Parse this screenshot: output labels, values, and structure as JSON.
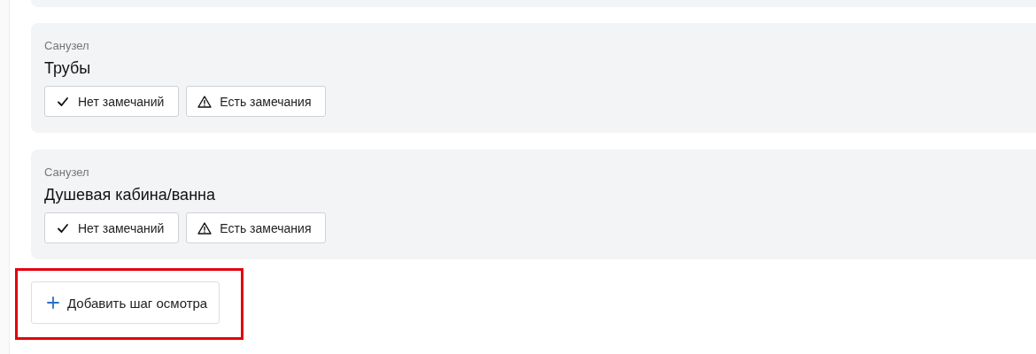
{
  "steps": [
    {
      "category": "Санузел",
      "title": "Трубы",
      "buttons": [
        {
          "kind": "ok",
          "label": "Нет замечаний"
        },
        {
          "kind": "issue",
          "label": "Есть замечания"
        }
      ]
    },
    {
      "category": "Санузел",
      "title": "Душевая кабина/ванна",
      "buttons": [
        {
          "kind": "ok",
          "label": "Нет замечаний"
        },
        {
          "kind": "issue",
          "label": "Есть замечания"
        }
      ]
    }
  ],
  "add_button": {
    "label": "Добавить шаг осмотра",
    "highlighted": true
  }
}
